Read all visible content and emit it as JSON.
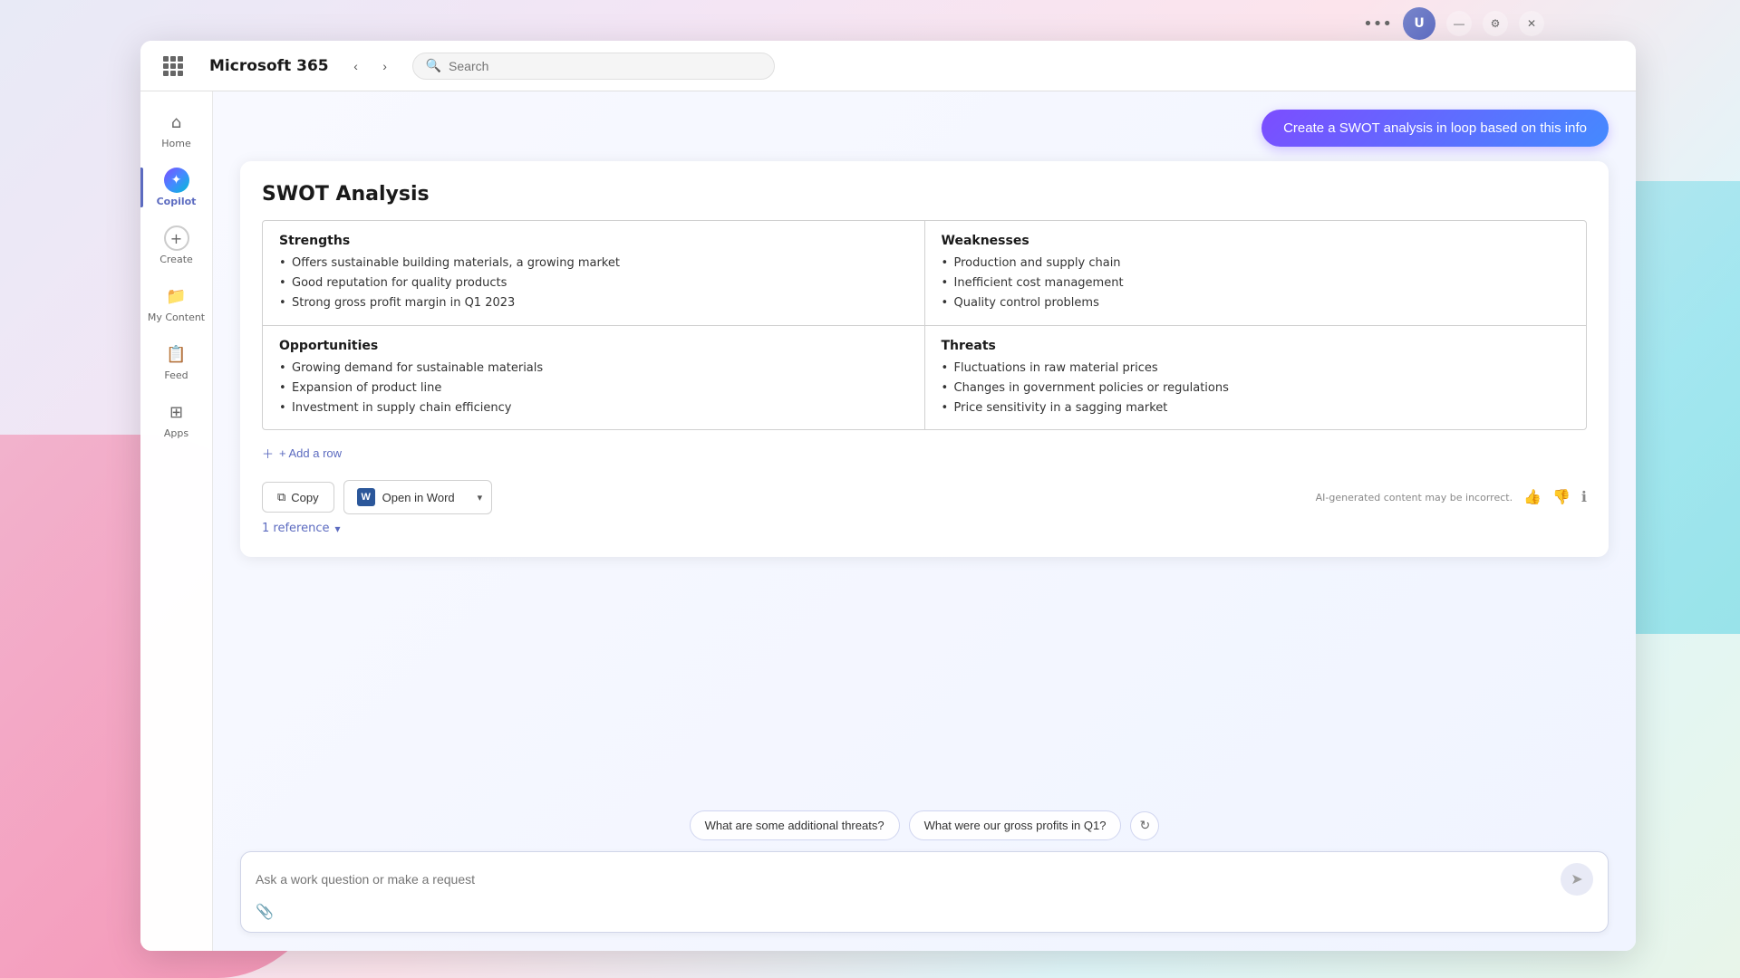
{
  "app": {
    "title": "Microsoft 365",
    "search_placeholder": "Search"
  },
  "window_controls": {
    "minimize": "—",
    "maximize": "□",
    "close": "✕",
    "more": "•••"
  },
  "nav": {
    "back": "‹",
    "forward": "›"
  },
  "sidebar": {
    "items": [
      {
        "id": "home",
        "label": "Home",
        "icon": "⌂"
      },
      {
        "id": "copilot",
        "label": "Copilot",
        "icon": "✦",
        "active": true
      },
      {
        "id": "create",
        "label": "Create",
        "icon": "+"
      },
      {
        "id": "my-content",
        "label": "My Content",
        "icon": "📁"
      },
      {
        "id": "feed",
        "label": "Feed",
        "icon": "📋"
      },
      {
        "id": "apps",
        "label": "Apps",
        "icon": "⊞"
      }
    ]
  },
  "create_swot_btn": "Create a SWOT analysis in loop based on this info",
  "swot": {
    "title": "SWOT Analysis",
    "quadrants": {
      "strengths": {
        "header": "Strengths",
        "items": [
          "Offers sustainable building materials, a growing market",
          "Good reputation for quality products",
          "Strong gross profit margin in Q1 2023"
        ]
      },
      "weaknesses": {
        "header": "Weaknesses",
        "items": [
          "Production and supply chain",
          "Inefficient cost management",
          "Quality control problems"
        ]
      },
      "opportunities": {
        "header": "Opportunities",
        "items": [
          "Growing demand for sustainable materials",
          "Expansion of product line",
          "Investment in supply chain efficiency"
        ]
      },
      "threats": {
        "header": "Threats",
        "items": [
          "Fluctuations in raw material prices",
          "Changes in government policies or regulations",
          "Price sensitivity in a sagging market"
        ]
      }
    },
    "add_row_label": "+ Add a row",
    "copy_label": "Copy",
    "open_word_label": "Open in Word",
    "ai_disclaimer": "AI-generated content may be incorrect.",
    "reference_label": "1 reference"
  },
  "suggestions": [
    "What are some additional threats?",
    "What were our gross profits in Q1?"
  ],
  "chat_input_placeholder": "Ask a work question or make a request"
}
